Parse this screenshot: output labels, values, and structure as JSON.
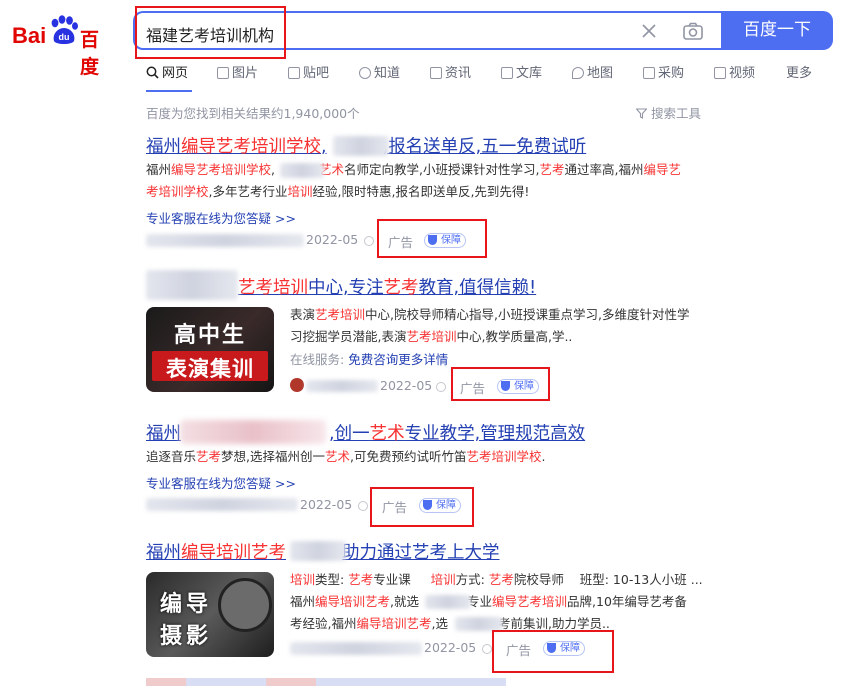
{
  "header": {
    "logo": {
      "text_left": "Bai",
      "text_paw": "du",
      "text_right": "百度"
    },
    "search": {
      "query": "福建艺考培训机构",
      "button_label": "百度一下"
    }
  },
  "tabs": [
    {
      "label": "网页",
      "icon": "search-icon",
      "active": true
    },
    {
      "label": "图片",
      "icon": "image-icon"
    },
    {
      "label": "贴吧",
      "icon": "tieba-icon"
    },
    {
      "label": "知道",
      "icon": "question-icon"
    },
    {
      "label": "资讯",
      "icon": "news-icon"
    },
    {
      "label": "文库",
      "icon": "doc-icon"
    },
    {
      "label": "地图",
      "icon": "map-icon"
    },
    {
      "label": "采购",
      "icon": "cart-icon"
    },
    {
      "label": "视频",
      "icon": "video-icon"
    },
    {
      "label": "更多"
    }
  ],
  "stats": "百度为您找到相关结果约1,940,000个",
  "tools_label": "搜索工具",
  "results": [
    {
      "title_pre": "福州",
      "title_em1": "编导艺考培训学校",
      "title_post1": ",",
      "title_blur_after": "",
      "title_rest": ",报名送单反,五一免费试听",
      "desc1_a": "福州",
      "desc1_em1": "编导艺考培训学校",
      "desc1_b": ",",
      "desc1_em2": "艺术",
      "desc1_c": "名师定向教学,小班授课针对性学习,",
      "desc1_em3": "艺考",
      "desc1_d": "通过率高,福州",
      "desc1_em4": "编导艺",
      "desc2_em1": "考培训学校",
      "desc2_a": ",多年艺考行业",
      "desc2_em2": "培训",
      "desc2_b": "经验,限时特惠,报名即送单反,先到先得!",
      "service": "专业客服在线为您答疑 >>",
      "date": "2022-05",
      "ad": "广告",
      "bao": "保障"
    },
    {
      "title_a": "艺考培训",
      "title_b": "中心,专注",
      "title_c": "艺考",
      "title_d": "教育,值得信赖!",
      "thumb_line1": "高中生",
      "thumb_line2": "表演集训",
      "desc1_a": "表演",
      "desc1_em1": "艺考培训",
      "desc1_b": "中心,院校导师精心指导,小班授课重点学习,多维度针对性学",
      "desc2_a": "习挖掘学员潜能,表演",
      "desc2_em1": "艺考培训",
      "desc2_b": "中心,教学质量高,学..",
      "service_label": "在线服务:",
      "service_link1": "免费咨询",
      "service_link2": "更多详情",
      "date": "2022-05",
      "ad": "广告",
      "bao": "保障"
    },
    {
      "title_a": "福州",
      "title_b": ",创一",
      "title_em": "艺术",
      "title_c": "专业教学,管理规范高效",
      "desc_a": "追逐音乐",
      "desc_em1": "艺考",
      "desc_b": "梦想,选择福州创一",
      "desc_em2": "艺术",
      "desc_c": ",可免费预约试听竹笛",
      "desc_em3": "艺考培训学校",
      "desc_d": ".",
      "service": "专业客服在线为您答疑 >>",
      "date": "2022-05",
      "ad": "广告",
      "bao": "保障"
    },
    {
      "title_a": "福州",
      "title_em": "编导培训艺考",
      "title_b": "助力通过艺考上大学",
      "thumb_line1": "编导",
      "thumb_line2": "摄影",
      "desc1_em1": "培训",
      "desc1_a": "类型: ",
      "desc1_em2": "艺考",
      "desc1_b": "专业课",
      "desc1_em3": "培训",
      "desc1_c": "方式: ",
      "desc1_em4": "艺考",
      "desc1_d": "院校导师",
      "desc1_e": "班型: 10-13人小班 ...",
      "desc2_a": "福州",
      "desc2_em1": "编导培训艺考",
      "desc2_b": ",就选",
      "desc2_c": "专业",
      "desc2_em2": "编导艺考培训",
      "desc2_d": "品牌,10年编导艺考备",
      "desc3_a": "考经验,福州",
      "desc3_em1": "编导培训艺考",
      "desc3_b": ",选",
      "desc3_c": "考前集训,助力学员..",
      "date": "2022-05",
      "ad": "广告",
      "bao": "保障"
    }
  ],
  "colors": {
    "brand_blue": "#4e6ef2",
    "brand_red": "#e10602",
    "link": "#2440b3",
    "highlight": "#f73131",
    "annotation_red": "#e8161b"
  }
}
